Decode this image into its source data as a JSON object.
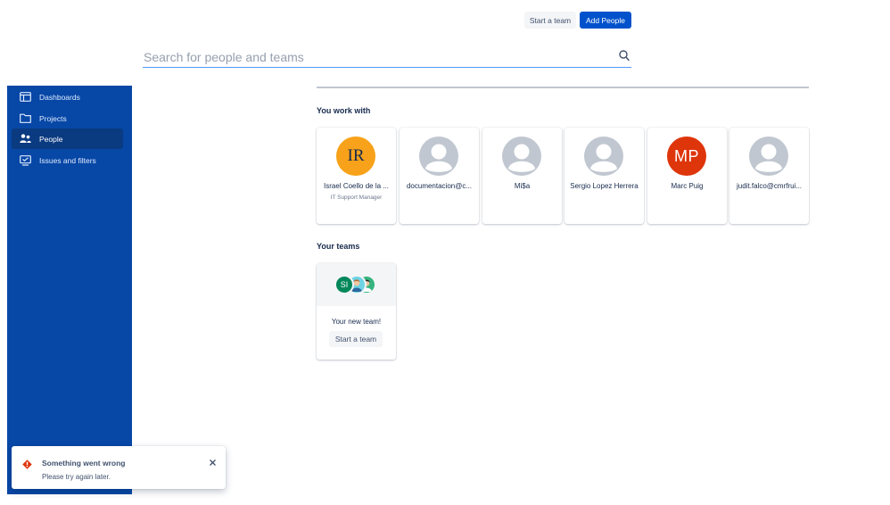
{
  "header": {
    "start_team_label": "Start a team",
    "add_people_label": "Add People"
  },
  "search": {
    "placeholder": "Search for people and teams",
    "icon": "search-icon"
  },
  "sidebar": {
    "background": "#0747a6",
    "items": [
      {
        "label": "Dashboards",
        "icon": "dashboard-icon",
        "active": false
      },
      {
        "label": "Projects",
        "icon": "folder-icon",
        "active": false
      },
      {
        "label": "People",
        "icon": "people-icon",
        "active": true
      },
      {
        "label": "Issues and filters",
        "icon": "issues-filter-icon",
        "active": false
      }
    ]
  },
  "you_work_with": {
    "title": "You work with",
    "people": [
      {
        "name": "Israel Coello de la ...",
        "role": "IT Support Manager",
        "avatar_initials": "IR",
        "avatar_color": "#f7a21a"
      },
      {
        "name": "documentacion@c...",
        "role": "",
        "avatar_initials": "",
        "avatar_color": "#c1c7d0"
      },
      {
        "name": "Mi$a",
        "role": "",
        "avatar_initials": "",
        "avatar_color": "#c1c7d0"
      },
      {
        "name": "Sergio Lopez Herrera",
        "role": "",
        "avatar_initials": "",
        "avatar_color": "#c1c7d0"
      },
      {
        "name": "Marc Puig",
        "role": "",
        "avatar_initials": "MP",
        "avatar_color": "#de350b"
      },
      {
        "name": "judit.falco@cmrfrui...",
        "role": "",
        "avatar_initials": "",
        "avatar_color": "#c1c7d0"
      }
    ]
  },
  "your_teams": {
    "title": "Your teams",
    "team_card": {
      "avatar_initials": "SI",
      "label": "Your new team!",
      "button_label": "Start a team"
    }
  },
  "toast": {
    "title": "Something went wrong",
    "body": "Please try again later.",
    "icon": "error-icon",
    "accent": "#de350b"
  },
  "colors": {
    "primary": "#0052cc",
    "search_focus": "#4c9aff"
  }
}
